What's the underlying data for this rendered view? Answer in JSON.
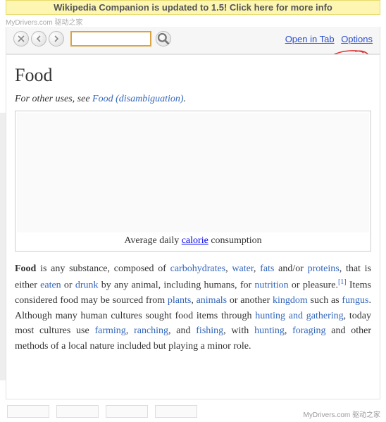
{
  "banner": {
    "text": "Wikipedia Companion is updated to 1.5! Click here for more info"
  },
  "watermark_top": "MyDrivers.com 驱动之家",
  "watermark_bottom": "MyDrivers.com 驱动之家",
  "toolbar": {
    "search_value": "",
    "search_placeholder": "",
    "links": {
      "open_in_tab": "Open in Tab",
      "options": "Options"
    }
  },
  "article": {
    "title": "Food",
    "hatnote_prefix": "For other uses, see ",
    "hatnote_link": "Food (disambiguation)",
    "hatnote_suffix": ".",
    "caption_prefix": "Average daily ",
    "caption_link": "calorie",
    "caption_suffix": " consumption",
    "body": {
      "t01": "Food",
      "t02": " is any substance, composed of ",
      "l01": "carbohydrates",
      "t03": ", ",
      "l02": "water",
      "t04": ", ",
      "l03": "fats",
      "t05": " and/or ",
      "l04": "proteins",
      "t06": ", that is either ",
      "l05": "eaten",
      "t07": " or ",
      "l06": "drunk",
      "t08": " by any animal, including humans, for ",
      "l07": "nutrition",
      "t09": " or pleasure.",
      "cite1": "[1]",
      "t10": " Items considered food may be sourced from ",
      "l08": "plants",
      "t11": ", ",
      "l09": "animals",
      "t12": " or another ",
      "l10": "kingdom",
      "t13": " such as ",
      "l11": "fungus",
      "t14": ". Although many human cultures sought food items through ",
      "l12": "hunting and gathering",
      "t15": ", today most cultures use ",
      "l13": "farming",
      "t16": ", ",
      "l14": "ranching",
      "t17": ", and ",
      "l15": "fishing",
      "t18": ", with ",
      "l16": "hunting",
      "t19": ", ",
      "l17": "foraging",
      "t20": " and other methods of a local nature included but playing a minor role."
    }
  }
}
